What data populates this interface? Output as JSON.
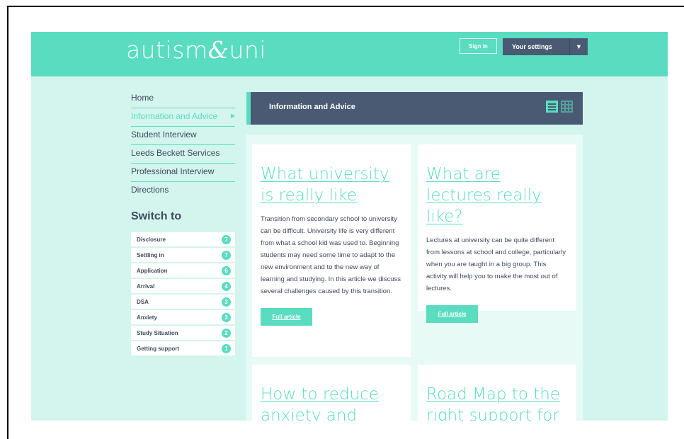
{
  "header": {
    "logo_pre": "autism",
    "logo_amp": "&",
    "logo_post": "uni",
    "signin_label": "Sign In",
    "settings_label": "Your settings",
    "settings_arrow": "▼"
  },
  "nav": {
    "items": [
      {
        "label": "Home"
      },
      {
        "label": "Information and Advice"
      },
      {
        "label": "Student Interview"
      },
      {
        "label": "Leeds Beckett Services"
      },
      {
        "label": "Professional Interview"
      },
      {
        "label": "Directions"
      }
    ],
    "active_caret": "▶"
  },
  "switch": {
    "title": "Switch to",
    "topics": [
      {
        "label": "Disclosure",
        "count": "7"
      },
      {
        "label": "Settling in",
        "count": "7"
      },
      {
        "label": "Application",
        "count": "6"
      },
      {
        "label": "Arrival",
        "count": "4"
      },
      {
        "label": "DSA",
        "count": "3"
      },
      {
        "label": "Anxiety",
        "count": "3"
      },
      {
        "label": "Study Situation",
        "count": "2"
      },
      {
        "label": "Getting support",
        "count": "1"
      }
    ]
  },
  "section": {
    "title": "Information and Advice"
  },
  "cards": [
    {
      "title": "What university is really like",
      "text": "Transition from secondary school to university can be difficult. University life is very different from what a school kid was used to. Beginning students may need some time to adapt to the new environment and to the new way of learning and studying. In this article we discuss several challenges caused by this transition.",
      "button": "Full article"
    },
    {
      "title": "What are lectures really like?",
      "text": "Lectures at university can be quite different from lessons at school and college, particularly when you are taught in a big group. This activity will help you to make the most out of lectures.",
      "button": "Full article"
    },
    {
      "title": "How to reduce anxiety and stress"
    },
    {
      "title": "Road Map to the right support for"
    }
  ],
  "colors": {
    "accent": "#5adcc0",
    "dark": "#4b5a73",
    "page_bg": "#d3f5ee"
  }
}
